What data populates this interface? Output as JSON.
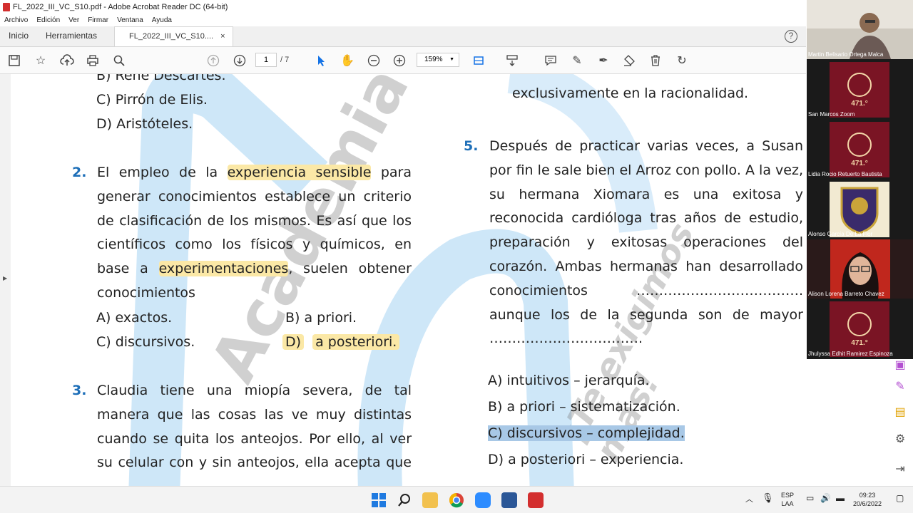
{
  "window": {
    "title": "FL_2022_III_VC_S10.pdf - Adobe Acrobat Reader DC (64-bit)"
  },
  "menu": [
    "Archivo",
    "Edición",
    "Ver",
    "Firmar",
    "Ventana",
    "Ayuda"
  ],
  "tabs": {
    "home": "Inicio",
    "tools": "Herramientas",
    "doc": "FL_2022_III_VC_S10....",
    "close": "×"
  },
  "toolbar": {
    "page_current": "1",
    "page_total": "/ 7",
    "zoom": "159%"
  },
  "watermark": {
    "academia": "Academia",
    "slogan": "¡Te exigimos más!"
  },
  "left_col": {
    "prev_opts": [
      "B)  René Descartes.",
      "C)  Pirrón de Elis.",
      "D)  Aristóteles."
    ],
    "q2": {
      "num": "2.",
      "l1a": "El empleo de la ",
      "l1hl": "experiencia sensible",
      "l1b": " para",
      "l2": "generar conocimientos establece un criterio",
      "l3": "de clasificación de los mismos. Es así que los",
      "l4": "científicos como los físicos y químicos, en",
      "l5a": "base a ",
      "l5hl": "experimentaciones",
      "l5b": ", suelen obtener",
      "l6": "conocimientos",
      "optA": "A)   exactos.",
      "optB": "B)    a priori.",
      "optC": "C)   discursivos.",
      "optD_letter": "D)",
      "optD_text": "a posteriori."
    },
    "q3": {
      "num": "3.",
      "l1": "Claudia tiene una miopía severa, de tal",
      "l2": "manera que las cosas las ve muy distintas",
      "l3": "cuando se quita los anteojos. Por ello, al ver",
      "l4": "su celular con y sin anteojos, ella acepta que"
    }
  },
  "right_col": {
    "prev_line": "exclusivamente en la racionalidad.",
    "q5": {
      "num": "5.",
      "l1": "Después de practicar varias veces, a Susan",
      "l2": "por fin le sale bien el Arroz con pollo. A la vez,",
      "l3": "su hermana Xiomara es una exitosa y",
      "l4": "reconocida cardióloga tras años de estudio,",
      "l5": "preparación y exitosas operaciones del",
      "l6": "corazón. Ambas hermanas han desarrollado",
      "l7a": "conocimientos",
      "l7b": "……………………………….",
      "l8": "aunque los de la segunda son de mayor",
      "l9": "…………………………….",
      "optA": "A)   intuitivos – jerarquía.",
      "optB": "B)   a priori – sistematización.",
      "optC": "C)   discursivos – complejidad.",
      "optD": "D)   a posteriori – experiencia."
    }
  },
  "participants": [
    {
      "name": "Martin Belisario Ortega Malca",
      "type": "video"
    },
    {
      "name": "San Marcos Zoom",
      "type": "crest"
    },
    {
      "name": "Lidia Rocio Retuerto Bautista",
      "type": "crest"
    },
    {
      "name": "Alonso García De La Flor",
      "type": "shield"
    },
    {
      "name": "Alison Lorena Barreto Chavez",
      "type": "video"
    },
    {
      "name": "Jhulyssa Edhit Ramirez Espinoza",
      "type": "crest"
    }
  ],
  "crest_label": "471.°",
  "taskbar": {
    "lang1": "ESP",
    "lang2": "LAA",
    "time": "09:23",
    "date": "20/6/2022"
  },
  "colors": {
    "accent_blue": "#1e6fb8",
    "highlight_yellow": "#fbe8a6",
    "selection_blue": "#a8c8e6",
    "crest_red": "#7a1424"
  }
}
